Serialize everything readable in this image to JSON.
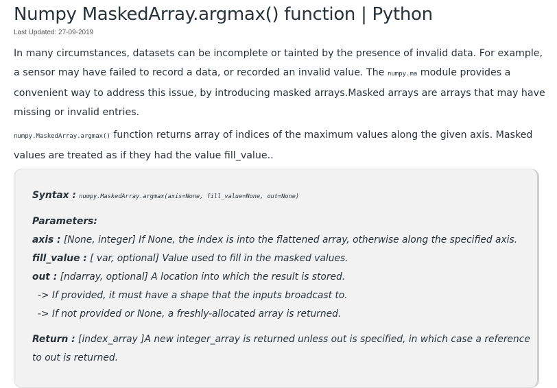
{
  "article": {
    "title": "Numpy MaskedArray.argmax() function | Python",
    "last_updated": "Last Updated: 27-09-2019",
    "intro": {
      "before_code": "In many circumstances, datasets can be incomplete or tainted by the presence of invalid data. For example, a sensor may have failed to record a data, or recorded an invalid value. The ",
      "code": "numpy.ma",
      "after_code": " module provides a convenient way to address this issue, by introducing masked arrays.Masked arrays are arrays that may have missing or invalid entries."
    },
    "description": {
      "code": "numpy.MaskedArray.argmax()",
      "text": " function returns array of indices of the maximum values along the given axis. Masked values are treated as if they had the value fill_value.."
    }
  },
  "syntax_box": {
    "syntax_label": "Syntax :",
    "syntax_code": "numpy.MaskedArray.argmax(axis=None, fill_value=None, out=None)",
    "parameters_label": "Parameters:",
    "params": [
      {
        "name": "axis :",
        "desc": " [None, integer] If None, the index is into the flattened array, otherwise along the specified axis."
      },
      {
        "name": "fill_value :",
        "desc": " [ var, optional] Value used to fill in the masked values."
      },
      {
        "name": "out :",
        "desc": " [ndarray, optional] A location into which the result is stored."
      }
    ],
    "out_notes": [
      "-> If provided, it must have a shape that the inputs broadcast to.",
      "-> If not provided or None, a freshly-allocated array is returned."
    ],
    "return_label": "Return :",
    "return_line1": " [index_array ]A new integer_array is returned unless out is specified, in which case a reference",
    "return_line2": "to out is returned."
  }
}
